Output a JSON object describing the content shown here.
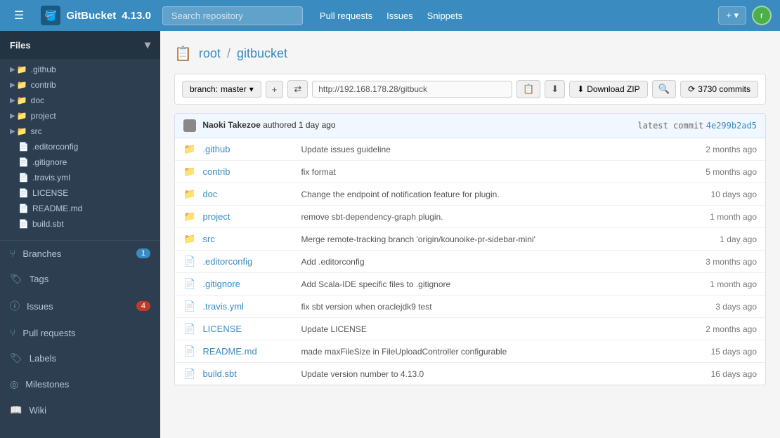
{
  "app": {
    "name": "GitBucket",
    "version": "4.13.0",
    "icon_label": "🪣"
  },
  "navbar": {
    "search_placeholder": "Search repository",
    "links": [
      "Pull requests",
      "Issues",
      "Snippets"
    ],
    "plus_label": "+ ▾",
    "avatar_label": "r"
  },
  "sidebar": {
    "files_section": "Files",
    "toggle_icon": "▾",
    "tree_items": [
      {
        "type": "folder",
        "name": ".github",
        "indent": 1
      },
      {
        "type": "folder",
        "name": "contrib",
        "indent": 1
      },
      {
        "type": "folder",
        "name": "doc",
        "indent": 1
      },
      {
        "type": "folder",
        "name": "project",
        "indent": 1
      },
      {
        "type": "folder",
        "name": "src",
        "indent": 1
      },
      {
        "type": "file",
        "name": ".editorconfig",
        "indent": 1
      },
      {
        "type": "file",
        "name": ".gitignore",
        "indent": 1
      },
      {
        "type": "file",
        "name": ".travis.yml",
        "indent": 1
      },
      {
        "type": "file",
        "name": "LICENSE",
        "indent": 1
      },
      {
        "type": "file",
        "name": "README.md",
        "indent": 1
      },
      {
        "type": "file",
        "name": "build.sbt",
        "indent": 1
      }
    ],
    "nav_items": [
      {
        "id": "branches",
        "icon": "⑂",
        "label": "Branches",
        "badge": "1"
      },
      {
        "id": "tags",
        "icon": "🏷",
        "label": "Tags",
        "badge": null
      },
      {
        "id": "issues",
        "icon": "ⓘ",
        "label": "Issues",
        "badge": "4",
        "badge_red": true
      },
      {
        "id": "pullrequests",
        "icon": "⑂",
        "label": "Pull requests",
        "badge": null
      },
      {
        "id": "labels",
        "icon": "🏷",
        "label": "Labels",
        "badge": null
      },
      {
        "id": "milestones",
        "icon": "◎",
        "label": "Milestones",
        "badge": null
      },
      {
        "id": "wiki",
        "icon": "📖",
        "label": "Wiki",
        "badge": null
      }
    ]
  },
  "repo": {
    "owner": "root",
    "name": "gitbucket",
    "branch": "master",
    "url": "http://192.168.178.28/gitbuck",
    "download_label": "Download ZIP",
    "commits_count": "3730 commits",
    "commits_label": "3730 commits"
  },
  "commit": {
    "author": "Naoki Takezoe",
    "action": "authored",
    "age": "1 day ago",
    "label_latest": "latest commit",
    "hash": "4e299b2ad5"
  },
  "files": [
    {
      "type": "folder",
      "name": ".github",
      "message": "Update issues guideline",
      "age": "2 months ago"
    },
    {
      "type": "folder",
      "name": "contrib",
      "message": "fix format",
      "age": "5 months ago"
    },
    {
      "type": "folder",
      "name": "doc",
      "message": "Change the endpoint of notification feature for plugin.",
      "age": "10 days ago"
    },
    {
      "type": "folder",
      "name": "project",
      "message": "remove sbt-dependency-graph plugin.",
      "age": "1 month ago"
    },
    {
      "type": "folder",
      "name": "src",
      "message": "Merge remote-tracking branch 'origin/kounoike-pr-sidebar-mini'",
      "age": "1 day ago"
    },
    {
      "type": "file",
      "name": ".editorconfig",
      "message": "Add .editorconfig",
      "age": "3 months ago"
    },
    {
      "type": "file",
      "name": ".gitignore",
      "message": "Add Scala-IDE specific files to .gitignore",
      "age": "1 month ago"
    },
    {
      "type": "file",
      "name": ".travis.yml",
      "message": "fix sbt version when oraclejdk9 test",
      "age": "3 days ago"
    },
    {
      "type": "file",
      "name": "LICENSE",
      "message": "Update LICENSE",
      "age": "2 months ago"
    },
    {
      "type": "file",
      "name": "README.md",
      "message": "made maxFileSize in FileUploadController configurable",
      "age": "15 days ago"
    },
    {
      "type": "file",
      "name": "build.sbt",
      "message": "Update version number to 4.13.0",
      "age": "16 days ago"
    }
  ]
}
